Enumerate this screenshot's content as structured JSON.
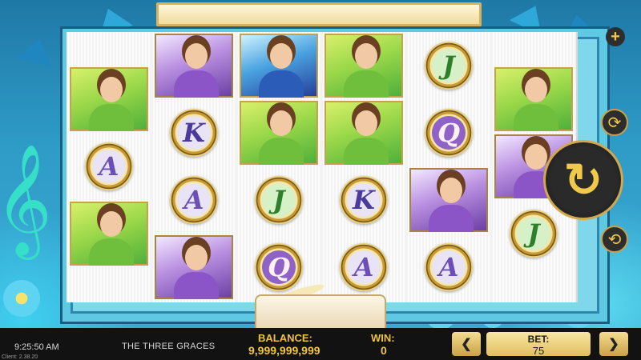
{
  "game": {
    "title": "THE THREE GRACES"
  },
  "reels": [
    [
      "char-green-grace",
      "card-A",
      "char-green-grace"
    ],
    [
      "char-purple-grace",
      "card-K",
      "card-A",
      "char-purple-grace"
    ],
    [
      "char-blue-grace",
      "char-green-grace",
      "card-J",
      "card-Q"
    ],
    [
      "char-green-grace",
      "char-green-grace",
      "card-K",
      "card-A"
    ],
    [
      "card-J",
      "card-Q",
      "char-purple-grace",
      "card-A"
    ],
    [
      "char-green-grace",
      "char-purple-grace",
      "card-J"
    ]
  ],
  "controls": {
    "plus_icon": "plus-icon",
    "autoplay_icon": "autoplay-icon",
    "spin_icon": "spin-icon",
    "turbo_icon": "turbo-icon",
    "plus_glyph": "+",
    "spin_glyph": "↻",
    "autoplay_glyph": "⟳",
    "turbo_glyph": "⟲"
  },
  "status_bar": {
    "time": "9:25:50 AM",
    "client_version": "Client: 2.38.20",
    "game_name": "THE THREE GRACES",
    "balance_label": "BALANCE:",
    "balance_value": "9,999,999,999",
    "win_label": "WIN:",
    "win_value": "0",
    "bet_label": "BET:",
    "bet_value": "75",
    "bet_decrease_glyph": "❮",
    "bet_increase_glyph": "❯"
  },
  "colors": {
    "accent_gold": "#f0c040",
    "bar_background": "#121212",
    "frame_blue": "#5fc8e3"
  }
}
